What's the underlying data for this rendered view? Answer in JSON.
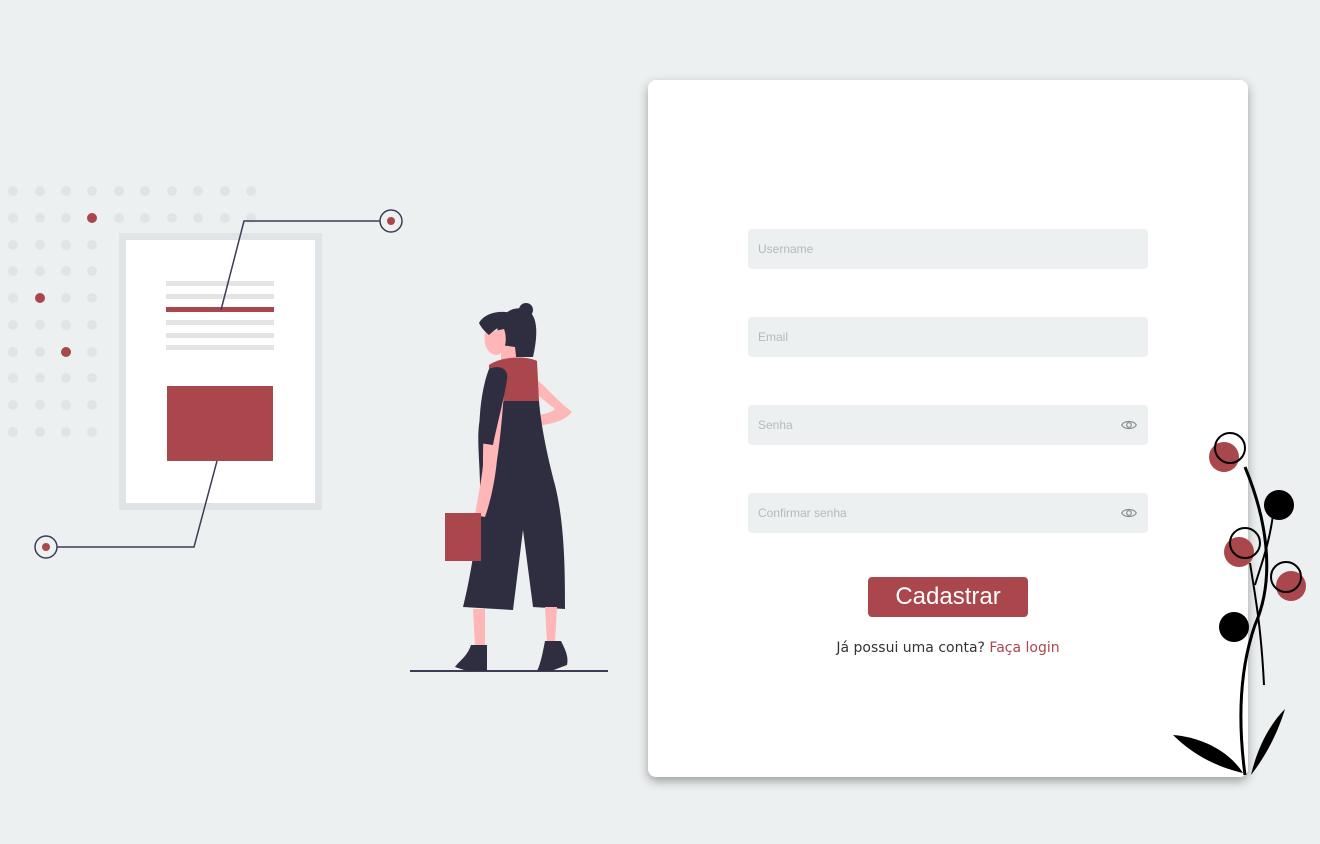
{
  "colors": {
    "accent": "#a9474c",
    "background": "#ecf0f1",
    "card": "#ffffff",
    "dark": "#2f2e41"
  },
  "illustrations": {
    "left": "document-illustration",
    "center": "woman-illustration",
    "corner": "flower-decoration"
  },
  "form": {
    "username_placeholder": "Username",
    "email_placeholder": "Email",
    "password_placeholder": "Senha",
    "confirm_password_placeholder": "Confirmar senha",
    "submit_label": "Cadastrar",
    "login_prompt": "Já possui uma conta?",
    "login_link": "Faça login",
    "password_toggle_icon": "eye-icon"
  }
}
